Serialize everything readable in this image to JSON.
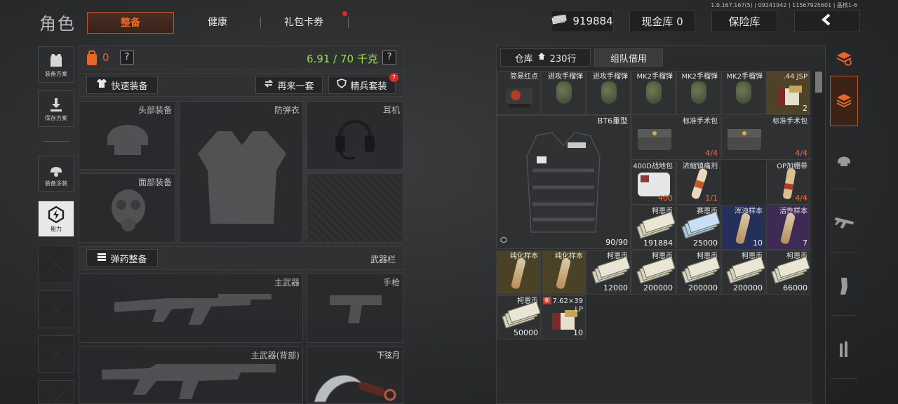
{
  "header": {
    "title": "角色",
    "tabs": [
      {
        "label": "整备",
        "active": true
      },
      {
        "label": "健康",
        "active": false
      },
      {
        "label": "礼包卡券",
        "active": false,
        "badge": "red-dot"
      }
    ],
    "currency_value": "919884",
    "cash_vault_label": "现金库 0",
    "safe_label": "保险库",
    "back_icon": "chevron-left-icon",
    "version_text": "1.0.167.167(5) | 09241942 | 11567925601 | 晶核1-6"
  },
  "sidebar": {
    "items": [
      {
        "label": "装备方案",
        "icon": "vest-icon"
      },
      {
        "label": "保存方案",
        "icon": "download-icon"
      },
      {
        "label": "装备涂装",
        "icon": "paint-helmet-icon"
      },
      {
        "label": "能力",
        "icon": "ability-icon",
        "active": true
      }
    ]
  },
  "loadout": {
    "backpack_count": "0",
    "help_mark": "?",
    "weight": "6.91 / 70 千克",
    "quick_equip": "快速装备",
    "repeat_set": "再来一套",
    "elite_set": "精兵套装",
    "elite_badge": "7",
    "slots": {
      "head": "头部装备",
      "armor": "防弹衣",
      "headset": "耳机",
      "face": "面部装备"
    },
    "ammo_equip": "弹药整备",
    "weapon_bar": "武器栏",
    "weapon_slots": {
      "primary": "主武器",
      "pistol": "手枪",
      "primary_back": "主武器(背部)",
      "melee": "下弦月"
    }
  },
  "inventory": {
    "tab_warehouse": "仓库",
    "tab_rows": "230行",
    "tab_team": "组队借用",
    "big_item": {
      "name": "BT6重型",
      "durability": "90/90"
    },
    "items": [
      {
        "name": "简易红点",
        "count": "",
        "bg": "",
        "kind": "scope"
      },
      {
        "name": "进攻手榴弹",
        "count": "",
        "bg": "",
        "kind": "grenade"
      },
      {
        "name": "进攻手榴弹",
        "count": "",
        "bg": "",
        "kind": "grenade"
      },
      {
        "name": "MK2手榴弹",
        "count": "",
        "bg": "",
        "kind": "grenade"
      },
      {
        "name": "MK2手榴弹",
        "count": "",
        "bg": "",
        "kind": "grenade"
      },
      {
        "name": "MK2手榴弹",
        "count": "",
        "bg": "",
        "kind": "grenade"
      },
      {
        "name": ".44 JSP",
        "count": "2",
        "bg": "gold",
        "kind": "ammo"
      },
      {
        "name": "标准手术包",
        "count": "4/4",
        "bg": "",
        "kind": "medkit",
        "wide": true,
        "red": true
      },
      {
        "name": "标准手术包",
        "count": "4/4",
        "bg": "",
        "kind": "medkit",
        "wide": true,
        "red": true
      },
      {
        "name": "400D战地包",
        "count": "400",
        "bg": "",
        "kind": "bag",
        "red": true
      },
      {
        "name": "浓缩镇痛剂",
        "count": "1/1",
        "bg": "",
        "kind": "syringe",
        "red": true
      },
      {
        "name": "OP加绷带",
        "count": "4/4",
        "bg": "",
        "kind": "bandage",
        "red": true
      },
      {
        "name": "柯恩币",
        "count": "191884",
        "bg": "",
        "kind": "money"
      },
      {
        "name": "赛恩币",
        "count": "25000",
        "bg": "",
        "kind": "money-blue"
      },
      {
        "name": "浑浊样本",
        "count": "10",
        "bg": "navy",
        "kind": "vial"
      },
      {
        "name": "活性样本",
        "count": "7",
        "bg": "purple",
        "kind": "vial"
      },
      {
        "name": "纯化样本",
        "count": "",
        "bg": "olive",
        "kind": "vial"
      },
      {
        "name": "纯化样本",
        "count": "",
        "bg": "olive",
        "kind": "vial"
      },
      {
        "name": "柯恩币",
        "count": "12000",
        "bg": "",
        "kind": "money"
      },
      {
        "name": "柯恩币",
        "count": "200000",
        "bg": "",
        "kind": "money"
      },
      {
        "name": "柯恩币",
        "count": "200000",
        "bg": "",
        "kind": "money"
      },
      {
        "name": "柯恩币",
        "count": "200000",
        "bg": "",
        "kind": "money"
      },
      {
        "name": "柯恩币",
        "count": "66000",
        "bg": "",
        "kind": "money"
      },
      {
        "name": "柯恩币",
        "count": "50000",
        "bg": "",
        "kind": "money"
      },
      {
        "name": "7.62×39 LP",
        "count": "10",
        "bg": "",
        "kind": "ammo",
        "new_badge": "新"
      }
    ]
  },
  "rail": {
    "icons": [
      "stack-refresh-icon",
      "stack-icon",
      "helmet-icon",
      "rifle-icon",
      "magazine-icon",
      "bullets-icon"
    ]
  },
  "colors": {
    "accent": "#f06a2c",
    "weight_green": "#9be03b",
    "backpack_orange": "#e8652c"
  }
}
